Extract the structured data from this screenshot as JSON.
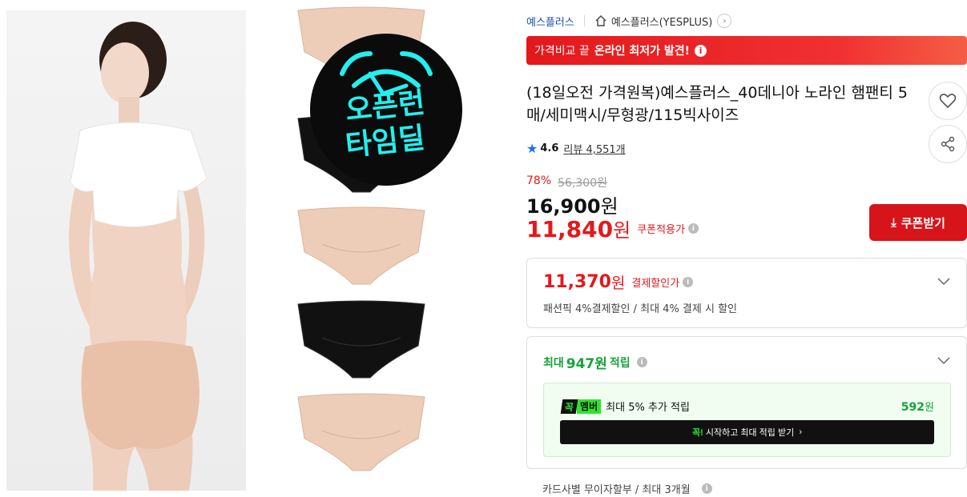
{
  "seller": {
    "brand_link": "예스플러스",
    "store_name": "예스플러스(YESPLUS)"
  },
  "promo": {
    "prefix": "가격비교 끝",
    "highlight": "온라인 최저가 발견!"
  },
  "product": {
    "title": "(18일오전 가격원복)예스플러스_40데니아 노라인 햄팬티 5매/세미맥시/무형광/115빅사이즈",
    "rating": "4.6",
    "review_label": "리뷰",
    "review_count": "4,551개"
  },
  "badge": {
    "line1": "오픈런",
    "line2": "타임딜"
  },
  "price": {
    "discount_rate": "78%",
    "original": "56,300원",
    "sale_num": "16,900",
    "sale_won": "원",
    "coupon_num": "11,840",
    "coupon_won": "원",
    "coupon_label": "쿠폰적용가",
    "coupon_button": "쿠폰받기"
  },
  "payment": {
    "num": "11,370",
    "won": "원",
    "label": "결제할인가",
    "sub": "패션픽 4%결제할인 / 최대 4% 결제 시 할인"
  },
  "points": {
    "prefix": "최대",
    "amount": "947원",
    "suffix": "적립",
    "member_badge_1": "꼭",
    "member_badge_2": "멤버",
    "member_text": "최대 5% 추가 적립",
    "member_pts_num": "592",
    "member_pts_won": "원",
    "member_btn_kk": "꼭!",
    "member_btn_text": "시작하고 최대 적립 받기",
    "member_btn_arrow": "›"
  },
  "installment": {
    "text": "카드사별 무이자할부 / 최대 3개월"
  },
  "colors": {
    "accent_red": "#e4181b",
    "point_green": "#19a23a",
    "member_green": "#2ee52e",
    "link_blue": "#1a4fb4"
  }
}
